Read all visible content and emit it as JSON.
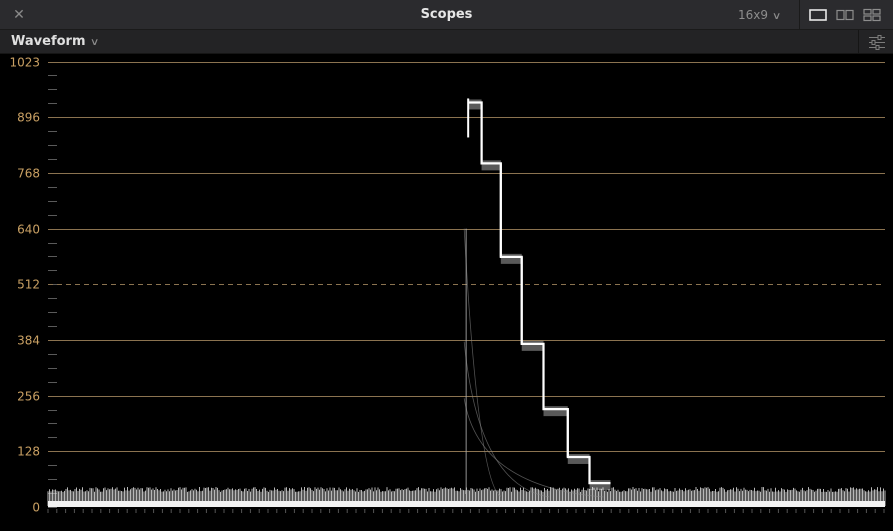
{
  "window": {
    "title": "Scopes",
    "close_icon": "close-icon",
    "aspect_ratio": "16x9",
    "layout_buttons": [
      "single-view-icon",
      "dual-view-icon",
      "quad-view-icon"
    ],
    "selected_layout": "single"
  },
  "toolbar": {
    "mode_label": "Waveform",
    "settings_icon": "sliders-icon"
  },
  "colors": {
    "graticule": "#8b7350",
    "axis_labels": "#c9a063",
    "trace": "#ffffff",
    "background": "#000000"
  },
  "scope": {
    "axis_labels": [
      "1023",
      "896",
      "768",
      "640",
      "512",
      "384",
      "256",
      "128",
      "0"
    ],
    "axis_values": [
      1023,
      896,
      768,
      640,
      512,
      384,
      256,
      128,
      0
    ],
    "dashed_level": 512,
    "range": [
      0,
      1023
    ],
    "steps": [
      {
        "x_from": 0.502,
        "x_to": 0.518,
        "level": 930
      },
      {
        "x_from": 0.518,
        "x_to": 0.541,
        "level": 790
      },
      {
        "x_from": 0.541,
        "x_to": 0.566,
        "level": 575
      },
      {
        "x_from": 0.566,
        "x_to": 0.592,
        "level": 375
      },
      {
        "x_from": 0.592,
        "x_to": 0.621,
        "level": 225
      },
      {
        "x_from": 0.621,
        "x_to": 0.647,
        "level": 115
      },
      {
        "x_from": 0.647,
        "x_to": 0.672,
        "level": 55
      }
    ],
    "noise_floor": 30
  }
}
